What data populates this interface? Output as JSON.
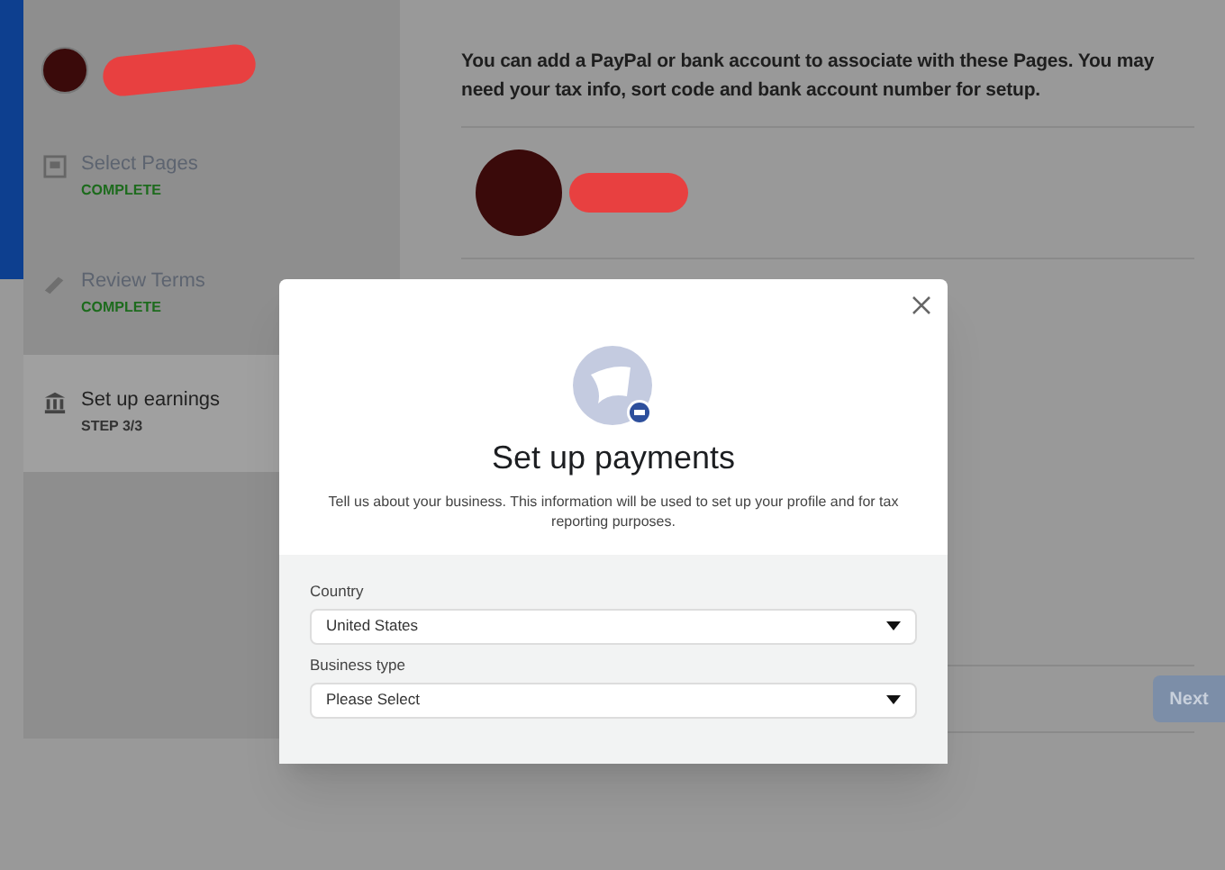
{
  "sidebar": {
    "steps": [
      {
        "label": "Select Pages",
        "status": "COMPLETE",
        "selected": false
      },
      {
        "label": "Review Terms",
        "status": "COMPLETE",
        "selected": false
      },
      {
        "label": "Set up earnings",
        "status": "STEP 3/3",
        "selected": true
      }
    ]
  },
  "main": {
    "intro": "You can add a PayPal or bank account to associate with these Pages. You may need your tax info, sort code and bank account number for setup.",
    "next_button": {
      "label": "Next",
      "disabled": true
    }
  },
  "dialog": {
    "title": "Set up payments",
    "description": "Tell us about your business. This information will be used to set up your profile and for tax reporting purposes.",
    "fields": [
      {
        "label": "Country",
        "value": "United States"
      },
      {
        "label": "Business type",
        "value": "Please Select"
      }
    ]
  }
}
